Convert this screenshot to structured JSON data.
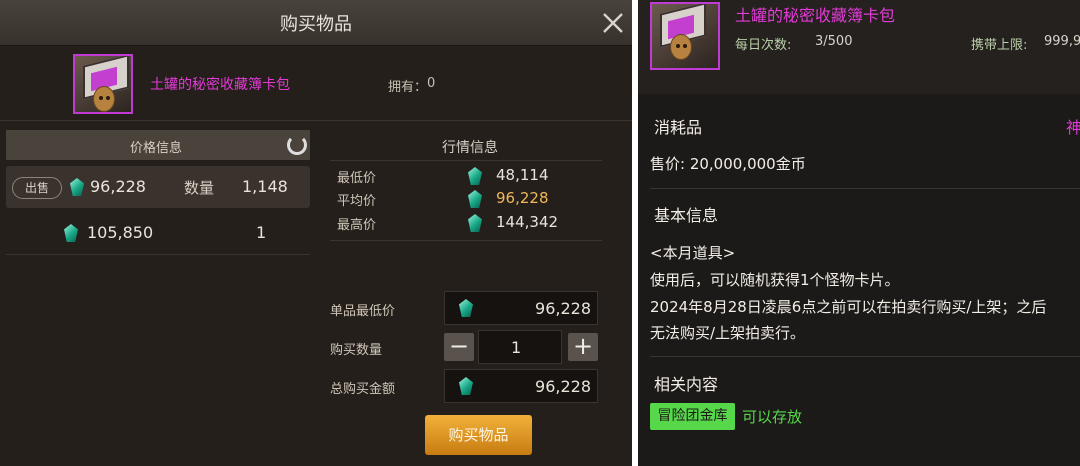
{
  "buy_window": {
    "title": "购买物品",
    "item_name": "土罐的秘密收藏簿卡包",
    "own_label": "拥有：",
    "own_value": "0",
    "price_info_label": "价格信息",
    "listings": [
      {
        "tag": "出售",
        "price": "96,228",
        "qty_label": "数量",
        "qty": "1,148"
      },
      {
        "price": "105,850",
        "qty": "1"
      }
    ],
    "market": {
      "label": "行情信息",
      "rows": [
        {
          "label": "最低价",
          "value": "48,114"
        },
        {
          "label": "平均价",
          "value": "96,228"
        },
        {
          "label": "最高价",
          "value": "144,342"
        }
      ]
    },
    "unit_min_label": "单品最低价",
    "unit_min_value": "96,228",
    "quantity_label": "购买数量",
    "quantity_value": "1",
    "minus_label": "−",
    "plus_label": "+",
    "total_label": "总购买金额",
    "total_value": "96,228",
    "buy_button_label": "购买物品"
  },
  "info_panel": {
    "item_name": "土罐的秘密收藏簿卡包",
    "daily_label": "每日次数:",
    "daily_value": "3/500",
    "carry_label": "携带上限:",
    "carry_value": "999,9",
    "category": "消耗品",
    "category_right": "神",
    "price_text": "售价: 20,000,000金币",
    "basic_info_title": "基本信息",
    "desc_lines": [
      "<本月道具>",
      "使用后，可以随机获得1个怪物卡片。",
      "2024年8月28日凌晨6点之前可以在拍卖行购买/上架；之后",
      "无法购买/上架拍卖行。"
    ],
    "related_title": "相关内容",
    "warehouse_badge": "冒险团金库",
    "storable_text": "可以存放"
  },
  "colors": {
    "item_name": "#e23bd6",
    "gold_text": "#f0b85a",
    "green_badge": "#56d84a",
    "buy_button": "#e9a02a"
  },
  "icons": [
    "close-icon",
    "refresh-icon",
    "gem-icon",
    "calculator-icon",
    "card-pack-icon"
  ]
}
